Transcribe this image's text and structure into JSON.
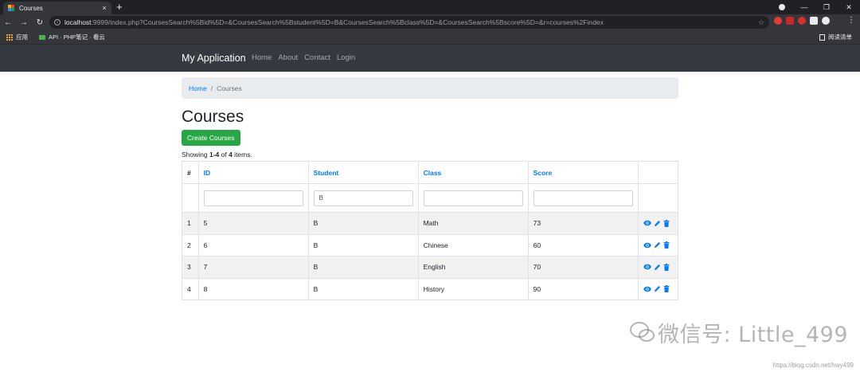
{
  "browser": {
    "tab_title": "Courses",
    "tab_close": "×",
    "new_tab": "+",
    "url_host": "localhost",
    "url_rest": ":9999/index.php?CoursesSearch%5Bid%5D=&CoursesSearch%5Bstudent%5D=B&CoursesSearch%5Bclass%5D=&CoursesSearch%5Bscore%5D=&r=courses%2Findex",
    "bookmarks": [
      {
        "label": "应用"
      },
      {
        "label": "API · PHP笔记 · 看云"
      }
    ],
    "reading_list": "阅读清单"
  },
  "app": {
    "brand": "My Application",
    "nav": [
      "Home",
      "About",
      "Contact",
      "Login"
    ]
  },
  "breadcrumb": {
    "home": "Home",
    "separator": "/",
    "current": "Courses"
  },
  "page_title": "Courses",
  "create_button": "Create Courses",
  "summary": {
    "prefix": "Showing ",
    "range": "1-4",
    "of": " of ",
    "total": "4",
    "suffix": " items."
  },
  "table": {
    "columns": [
      "#",
      "ID",
      "Student",
      "Class",
      "Score"
    ],
    "filters": {
      "id": "",
      "student": "B",
      "class": "",
      "score": ""
    },
    "rows": [
      {
        "n": "1",
        "id": "5",
        "student": "B",
        "class": "Math",
        "score": "73"
      },
      {
        "n": "2",
        "id": "6",
        "student": "B",
        "class": "Chinese",
        "score": "60"
      },
      {
        "n": "3",
        "id": "7",
        "student": "B",
        "class": "English",
        "score": "70"
      },
      {
        "n": "4",
        "id": "8",
        "student": "B",
        "class": "History",
        "score": "90"
      }
    ]
  },
  "watermark": "微信号: Little_499",
  "credit": "https://blog.csdn.net/hwy499",
  "colors": {
    "link": "#007bff",
    "success": "#28a745",
    "navbar": "#343a40"
  }
}
